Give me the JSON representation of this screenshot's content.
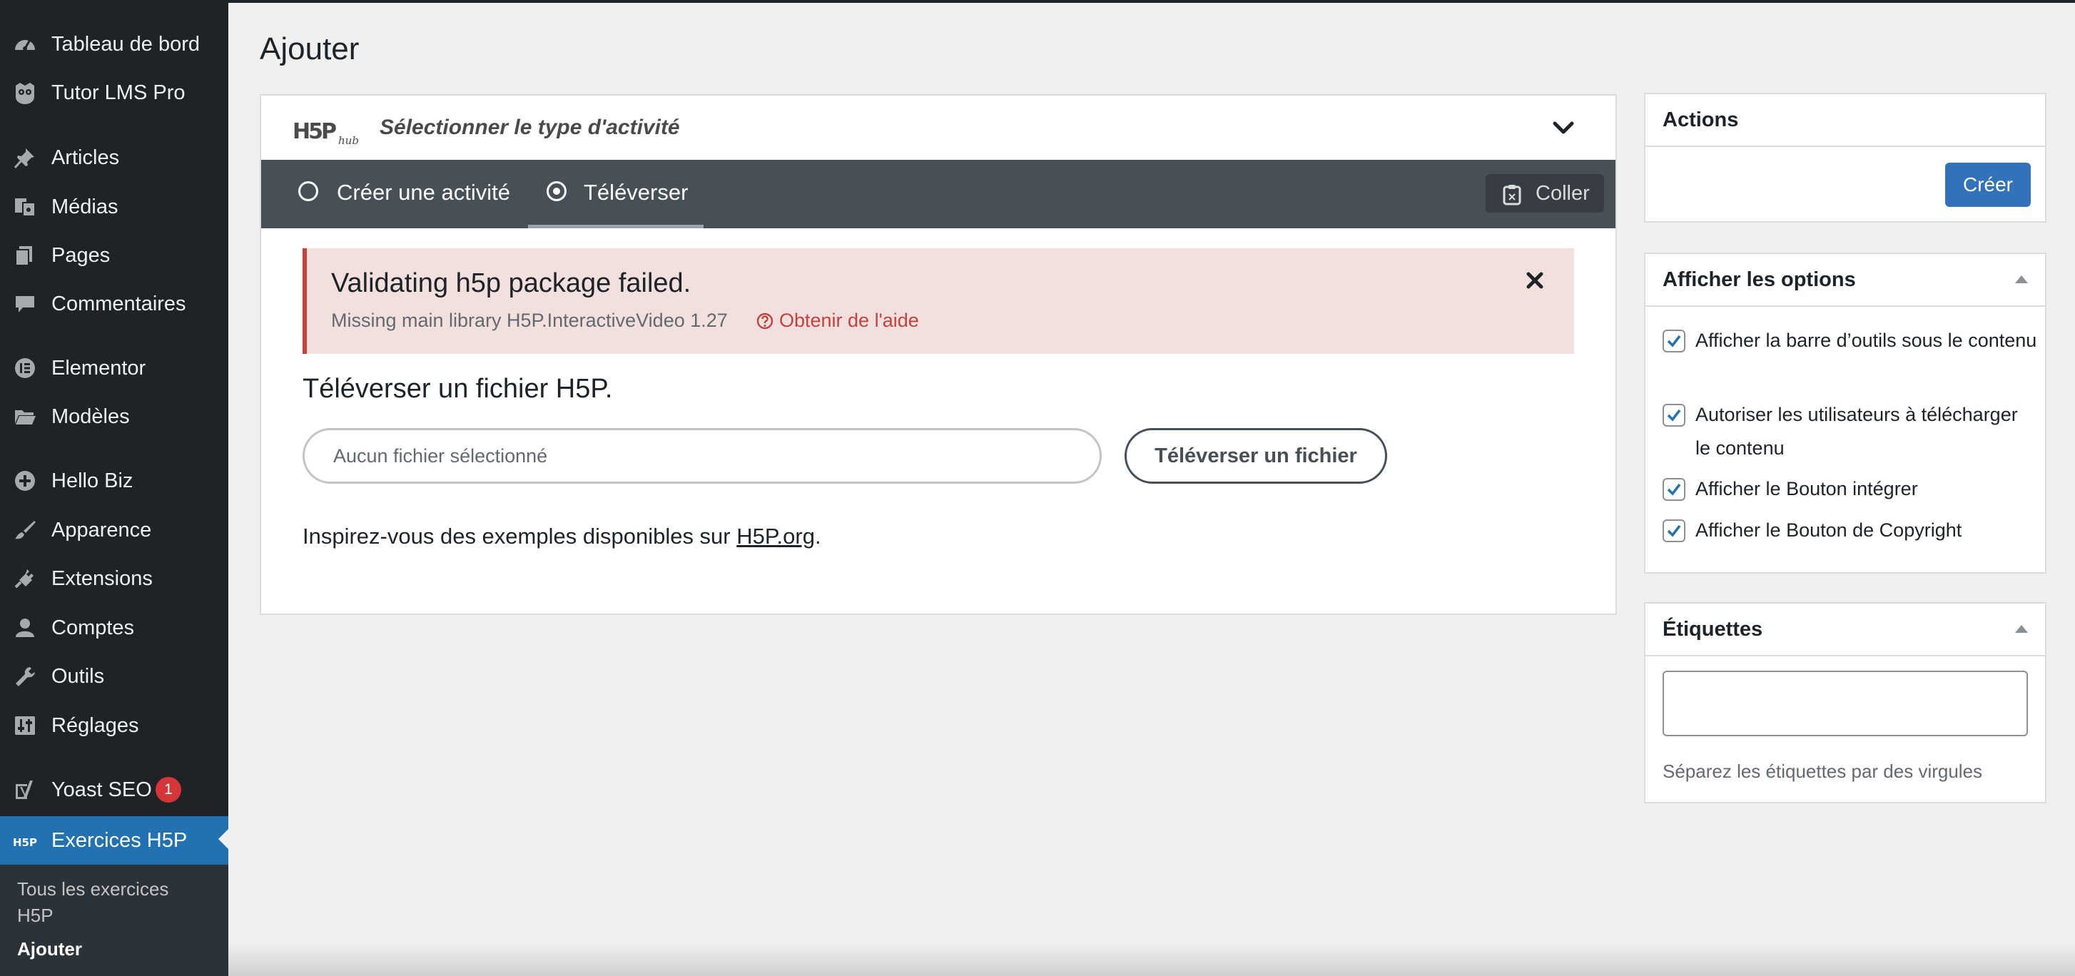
{
  "sidebar": {
    "items": [
      {
        "label": "Tableau de bord",
        "icon": "dashboard-icon"
      },
      {
        "label": "Tutor LMS Pro",
        "icon": "tutor-owl-icon"
      },
      {
        "label": "Articles",
        "icon": "pushpin-icon"
      },
      {
        "label": "Médias",
        "icon": "media-icon"
      },
      {
        "label": "Pages",
        "icon": "pages-icon"
      },
      {
        "label": "Commentaires",
        "icon": "comment-icon"
      },
      {
        "label": "Elementor",
        "icon": "elementor-icon"
      },
      {
        "label": "Modèles",
        "icon": "folder-icon"
      },
      {
        "label": "Hello Biz",
        "icon": "plus-circle-icon"
      },
      {
        "label": "Apparence",
        "icon": "paintbrush-icon"
      },
      {
        "label": "Extensions",
        "icon": "plug-icon"
      },
      {
        "label": "Comptes",
        "icon": "user-icon"
      },
      {
        "label": "Outils",
        "icon": "wrench-icon"
      },
      {
        "label": "Réglages",
        "icon": "settings-sliders-icon"
      },
      {
        "label": "Yoast SEO",
        "icon": "yoast-icon",
        "badge": "1"
      },
      {
        "label": "Exercices H5P",
        "icon": "h5p-icon",
        "active": true
      }
    ],
    "submenu": {
      "all_line1": "Tous les exercices",
      "all_line2": "H5P",
      "add": "Ajouter"
    }
  },
  "page": {
    "title": "Ajouter"
  },
  "hub": {
    "logo_text": "H5P",
    "logo_sub": "hub",
    "title": "Sélectionner le type d'activité",
    "tabs": [
      {
        "label": "Créer une activité",
        "selected": false
      },
      {
        "label": "Téléverser",
        "selected": true
      }
    ],
    "paste_label": "Coller"
  },
  "error": {
    "title": "Validating h5p package failed.",
    "message": "Missing main library H5P.InteractiveVideo 1.27",
    "help_link": "Obtenir de l'aide"
  },
  "upload": {
    "title": "Téléverser un fichier H5P.",
    "placeholder": "Aucun fichier sélectionné",
    "button": "Téléverser un fichier",
    "inspire_prefix": "Inspirez-vous des exemples disponibles sur ",
    "inspire_link": "H5P.org",
    "inspire_suffix": "."
  },
  "actions": {
    "title": "Actions",
    "create_button": "Créer"
  },
  "display_options": {
    "title": "Afficher les options",
    "options": [
      {
        "label": "Afficher la barre d’outils sous le contenu",
        "checked": true
      },
      {
        "label": "Autoriser les utilisateurs à télécharger le contenu",
        "checked": true
      },
      {
        "label": "Afficher le Bouton intégrer",
        "checked": true
      },
      {
        "label": "Afficher le Bouton de Copyright",
        "checked": true
      }
    ]
  },
  "tags": {
    "title": "Étiquettes",
    "value": "",
    "hint": "Séparez les étiquettes par des virgules"
  },
  "colors": {
    "sidebar_bg": "#1d2327",
    "active_blue": "#2271b1",
    "tabbar_bg": "#474f57",
    "error_bg": "#f2e0df",
    "error_border": "#c4413c",
    "primary_button": "#3272b9"
  }
}
